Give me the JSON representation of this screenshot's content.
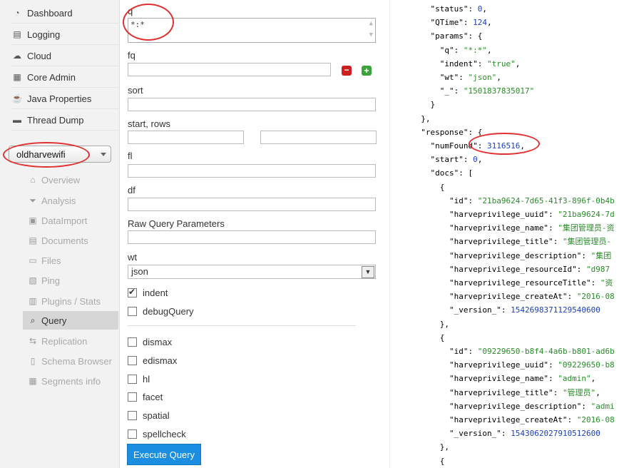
{
  "sidebar": {
    "nav": [
      {
        "label": "Dashboard",
        "icon": "dashboard-icon",
        "glyph": "◔"
      },
      {
        "label": "Logging",
        "icon": "logging-icon",
        "glyph": "▤"
      },
      {
        "label": "Cloud",
        "icon": "cloud-icon",
        "glyph": "☁"
      },
      {
        "label": "Core Admin",
        "icon": "core-admin-icon",
        "glyph": "▦"
      },
      {
        "label": "Java Properties",
        "icon": "java-properties-icon",
        "glyph": "☕"
      },
      {
        "label": "Thread Dump",
        "icon": "thread-dump-icon",
        "glyph": "▬"
      }
    ],
    "core_selector": "oldharvewifi",
    "core_menu": [
      {
        "label": "Overview",
        "icon": "overview-icon",
        "glyph": "⌂"
      },
      {
        "label": "Analysis",
        "icon": "analysis-icon",
        "glyph": "⏷"
      },
      {
        "label": "DataImport",
        "icon": "dataimport-icon",
        "glyph": "▣"
      },
      {
        "label": "Documents",
        "icon": "documents-icon",
        "glyph": "▤"
      },
      {
        "label": "Files",
        "icon": "files-icon",
        "glyph": "▭"
      },
      {
        "label": "Ping",
        "icon": "ping-icon",
        "glyph": "▧"
      },
      {
        "label": "Plugins / Stats",
        "icon": "plugins-icon",
        "glyph": "▥"
      },
      {
        "label": "Query",
        "icon": "query-icon",
        "glyph": "⌕"
      },
      {
        "label": "Replication",
        "icon": "replication-icon",
        "glyph": "⇆"
      },
      {
        "label": "Schema Browser",
        "icon": "schema-browser-icon",
        "glyph": "▯"
      },
      {
        "label": "Segments info",
        "icon": "segments-icon",
        "glyph": "▦"
      }
    ]
  },
  "form": {
    "q_label": "q",
    "q_value": "*:*",
    "fq_label": "fq",
    "fq_value": "",
    "sort_label": "sort",
    "start_rows_label": "start, rows",
    "fl_label": "fl",
    "df_label": "df",
    "raw_label": "Raw Query Parameters",
    "wt_label": "wt",
    "wt_value": "json",
    "indent_label": "indent",
    "debug_label": "debugQuery",
    "dismax_label": "dismax",
    "edismax_label": "edismax",
    "hl_label": "hl",
    "facet_label": "facet",
    "spatial_label": "spatial",
    "spellcheck_label": "spellcheck",
    "execute_label": "Execute Query",
    "minus_glyph": "−",
    "plus_glyph": "+"
  },
  "json_lines": [
    {
      "i": "    ",
      "k": "\"status\"",
      "v": "0",
      "t": "n",
      "tail": ","
    },
    {
      "i": "    ",
      "k": "\"QTime\"",
      "v": "124",
      "t": "n",
      "tail": ","
    },
    {
      "i": "    ",
      "k": "\"params\"",
      "v": "",
      "t": "",
      "tail": "{"
    },
    {
      "i": "      ",
      "k": "\"q\"",
      "v": "\"*:*\"",
      "t": "s",
      "tail": ","
    },
    {
      "i": "      ",
      "k": "\"indent\"",
      "v": "\"true\"",
      "t": "s",
      "tail": ","
    },
    {
      "i": "      ",
      "k": "\"wt\"",
      "v": "\"json\"",
      "t": "s",
      "tail": ","
    },
    {
      "i": "      ",
      "k": "\"_\"",
      "v": "\"1501837835017\"",
      "t": "s",
      "tail": ""
    },
    {
      "i": "    ",
      "raw": "}"
    },
    {
      "i": "  ",
      "raw": "},"
    },
    {
      "i": "  ",
      "k": "\"response\"",
      "v": "",
      "t": "",
      "tail": "{"
    },
    {
      "i": "    ",
      "k": "\"numFound\"",
      "v": "3116516",
      "t": "n",
      "tail": ","
    },
    {
      "i": "    ",
      "k": "\"start\"",
      "v": "0",
      "t": "n",
      "tail": ","
    },
    {
      "i": "    ",
      "k": "\"docs\"",
      "v": "",
      "t": "",
      "tail": "["
    },
    {
      "i": "      ",
      "raw": "{"
    },
    {
      "i": "        ",
      "k": "\"id\"",
      "v": "\"21ba9624-7d65-41f3-896f-0b4b",
      "t": "s",
      "tail": ""
    },
    {
      "i": "        ",
      "k": "\"harveprivilege_uuid\"",
      "v": "\"21ba9624-7d",
      "t": "s",
      "tail": ""
    },
    {
      "i": "        ",
      "k": "\"harveprivilege_name\"",
      "v": "\"集团管理员-资",
      "t": "s",
      "tail": ""
    },
    {
      "i": "        ",
      "k": "\"harveprivilege_title\"",
      "v": "\"集团管理员-",
      "t": "s",
      "tail": ""
    },
    {
      "i": "        ",
      "k": "\"harveprivilege_description\"",
      "v": "\"集团",
      "t": "s",
      "tail": ""
    },
    {
      "i": "        ",
      "k": "\"harveprivilege_resourceId\"",
      "v": "\"d987",
      "t": "s",
      "tail": ""
    },
    {
      "i": "        ",
      "k": "\"harveprivilege_resourceTitle\"",
      "v": "\"资",
      "t": "s",
      "tail": ""
    },
    {
      "i": "        ",
      "k": "\"harveprivilege_createAt\"",
      "v": "\"2016-08",
      "t": "s",
      "tail": ""
    },
    {
      "i": "        ",
      "k": "\"_version_\"",
      "v": "1542698371129540600",
      "t": "n",
      "tail": ""
    },
    {
      "i": "      ",
      "raw": "},"
    },
    {
      "i": "      ",
      "raw": "{"
    },
    {
      "i": "        ",
      "k": "\"id\"",
      "v": "\"09229650-b8f4-4a6b-b801-ad6b",
      "t": "s",
      "tail": ""
    },
    {
      "i": "        ",
      "k": "\"harveprivilege_uuid\"",
      "v": "\"09229650-b8",
      "t": "s",
      "tail": ""
    },
    {
      "i": "        ",
      "k": "\"harveprivilege_name\"",
      "v": "\"admin\"",
      "t": "s",
      "tail": ","
    },
    {
      "i": "        ",
      "k": "\"harveprivilege_title\"",
      "v": "\"管理员\"",
      "t": "s",
      "tail": ","
    },
    {
      "i": "        ",
      "k": "\"harveprivilege_description\"",
      "v": "\"admi",
      "t": "s",
      "tail": ""
    },
    {
      "i": "        ",
      "k": "\"harveprivilege_createAt\"",
      "v": "\"2016-08",
      "t": "s",
      "tail": ""
    },
    {
      "i": "        ",
      "k": "\"_version_\"",
      "v": "1543062027910512600",
      "t": "n",
      "tail": ""
    },
    {
      "i": "      ",
      "raw": "},"
    },
    {
      "i": "      ",
      "raw": "{"
    }
  ]
}
